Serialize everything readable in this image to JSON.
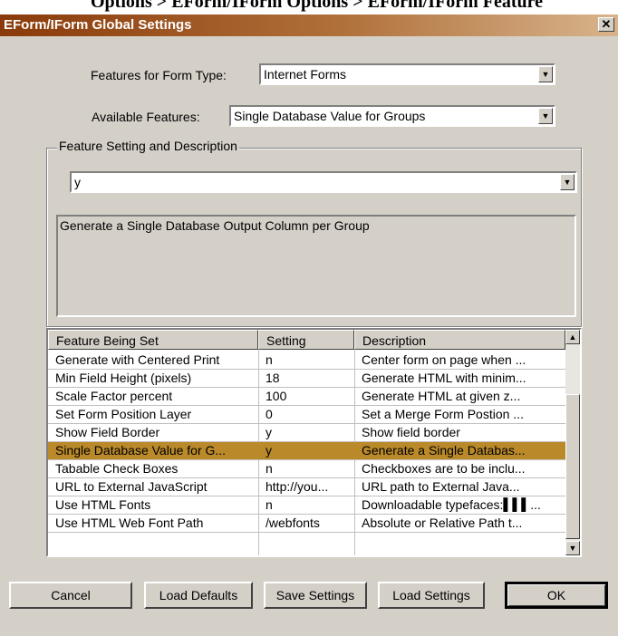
{
  "context_title": "Options > EForm/IForm Options > EForm/IForm Feature",
  "window": {
    "title": "EForm/IForm Global Settings",
    "close_glyph": "✕"
  },
  "form_type": {
    "label": "Features for Form Type:",
    "value": "Internet Forms"
  },
  "available_features": {
    "label": "Available Features:",
    "value": "Single Database Value for Groups"
  },
  "feature_setting": {
    "group_label": "Feature Setting and Description",
    "value": "y",
    "description": "Generate a Single Database Output Column per Group"
  },
  "table": {
    "columns": [
      "Feature Being Set",
      "Setting",
      "Description"
    ],
    "rows": [
      {
        "feature": "Generate with Centered Print",
        "setting": "n",
        "description": "Center form on page when ..."
      },
      {
        "feature": "Min Field Height (pixels)",
        "setting": "18",
        "description": "Generate HTML with minim..."
      },
      {
        "feature": "Scale Factor percent",
        "setting": "100",
        "description": "Generate HTML at given z..."
      },
      {
        "feature": "Set Form Position Layer",
        "setting": "0",
        "description": "Set a Merge Form Postion ..."
      },
      {
        "feature": "Show Field Border",
        "setting": "y",
        "description": "Show field border"
      },
      {
        "feature": "Single Database Value for G...",
        "setting": "y",
        "description": "Generate a Single Databas..."
      },
      {
        "feature": "Tabable Check Boxes",
        "setting": "n",
        "description": "Checkboxes are to be inclu..."
      },
      {
        "feature": "URL to External JavaScript",
        "setting": "http://you...",
        "description": "URL path to External Java..."
      },
      {
        "feature": "Use HTML Fonts",
        "setting": "n",
        "description": "Downloadable typefaces:▌▌▌..."
      },
      {
        "feature": "Use HTML Web Font Path",
        "setting": "/webfonts",
        "description": "Absolute or Relative Path t..."
      }
    ],
    "selected_row_index": 5
  },
  "buttons": {
    "cancel": "Cancel",
    "load_defaults": "Load Defaults",
    "save_settings": "Save Settings",
    "load_settings": "Load Settings",
    "ok": "OK"
  },
  "colors": {
    "selection": "#b9892a",
    "titlebar_start": "#8a3a0a",
    "dialog_face": "#d4d0c8"
  }
}
